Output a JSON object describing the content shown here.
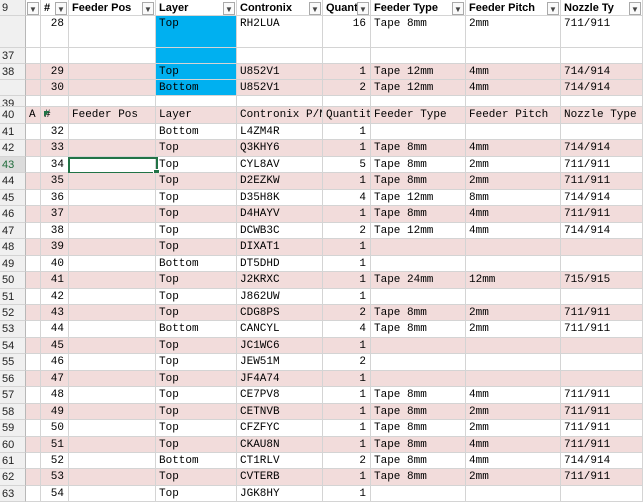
{
  "header_top": {
    "row_header": "9",
    "columns": [
      "#",
      "Feeder Pos",
      "Layer",
      "Contronix",
      "Quanti",
      "Feeder Type",
      "Feeder Pitch",
      "Nozzle Ty"
    ]
  },
  "top_rows": [
    {
      "rh": "",
      "num": "28",
      "pos": "",
      "layer": "Top",
      "part": "RH2LUA",
      "qty": "16",
      "ftype": "Tape 8mm",
      "pitch": "2mm",
      "nozzle": "711/911"
    },
    {
      "rh": "37",
      "num": "",
      "pos": "",
      "layer": "",
      "part": "",
      "qty": "",
      "ftype": "",
      "pitch": "",
      "nozzle": ""
    },
    {
      "rh": "38",
      "num": "29",
      "pos": "",
      "layer": "Top",
      "part": "U852V1",
      "qty": "1",
      "ftype": "Tape 12mm",
      "pitch": "4mm",
      "nozzle": "714/914"
    },
    {
      "rh": "",
      "num": "30",
      "pos": "",
      "layer": "Bottom",
      "part": "U852V1",
      "qty": "2",
      "ftype": "Tape 12mm",
      "pitch": "4mm",
      "nozzle": "714/914"
    },
    {
      "rh": "39",
      "num": "",
      "pos": "",
      "layer": "",
      "part": "",
      "qty": "",
      "ftype": "",
      "pitch": "",
      "nozzle": ""
    }
  ],
  "header_second": {
    "row_header": "40",
    "cells": [
      "A",
      "#",
      "Feeder Pos",
      "Layer",
      "Contronix P/N",
      "Quantity",
      "Feeder Type",
      "Feeder Pitch",
      "Nozzle Type"
    ]
  },
  "rows": [
    {
      "rh": "41",
      "num": "32",
      "layer": "Bottom",
      "part": "L4ZM4R",
      "qty": "1",
      "ftype": "",
      "pitch": "",
      "nozzle": ""
    },
    {
      "rh": "42",
      "num": "33",
      "layer": "Top",
      "part": "Q3KHY6",
      "qty": "1",
      "ftype": "Tape 8mm",
      "pitch": "4mm",
      "nozzle": "714/914"
    },
    {
      "rh": "43",
      "num": "34",
      "layer": "Top",
      "part": "CYL8AV",
      "qty": "5",
      "ftype": "Tape 8mm",
      "pitch": "2mm",
      "nozzle": "711/911"
    },
    {
      "rh": "44",
      "num": "35",
      "layer": "Top",
      "part": "D2EZKW",
      "qty": "1",
      "ftype": "Tape 8mm",
      "pitch": "2mm",
      "nozzle": "711/911"
    },
    {
      "rh": "45",
      "num": "36",
      "layer": "Top",
      "part": "D35H8K",
      "qty": "4",
      "ftype": "Tape 12mm",
      "pitch": "8mm",
      "nozzle": "714/914"
    },
    {
      "rh": "46",
      "num": "37",
      "layer": "Top",
      "part": "D4HAYV",
      "qty": "1",
      "ftype": "Tape 8mm",
      "pitch": "4mm",
      "nozzle": "711/911"
    },
    {
      "rh": "47",
      "num": "38",
      "layer": "Top",
      "part": "DCWB3C",
      "qty": "2",
      "ftype": "Tape 12mm",
      "pitch": "4mm",
      "nozzle": "714/914"
    },
    {
      "rh": "48",
      "num": "39",
      "layer": "Top",
      "part": "DIXAT1",
      "qty": "1",
      "ftype": "",
      "pitch": "",
      "nozzle": ""
    },
    {
      "rh": "49",
      "num": "40",
      "layer": "Bottom",
      "part": "DT5DHD",
      "qty": "1",
      "ftype": "",
      "pitch": "",
      "nozzle": ""
    },
    {
      "rh": "50",
      "num": "41",
      "layer": "Top",
      "part": "J2KRXC",
      "qty": "1",
      "ftype": "Tape 24mm",
      "pitch": "12mm",
      "nozzle": "715/915"
    },
    {
      "rh": "51",
      "num": "42",
      "layer": "Top",
      "part": "J862UW",
      "qty": "1",
      "ftype": "",
      "pitch": "",
      "nozzle": ""
    },
    {
      "rh": "52",
      "num": "43",
      "layer": "Top",
      "part": "CDG8PS",
      "qty": "2",
      "ftype": "Tape 8mm",
      "pitch": "2mm",
      "nozzle": "711/911"
    },
    {
      "rh": "53",
      "num": "44",
      "layer": "Bottom",
      "part": "CANCYL",
      "qty": "4",
      "ftype": "Tape 8mm",
      "pitch": "2mm",
      "nozzle": "711/911"
    },
    {
      "rh": "54",
      "num": "45",
      "layer": "Top",
      "part": "JC1WC6",
      "qty": "1",
      "ftype": "",
      "pitch": "",
      "nozzle": ""
    },
    {
      "rh": "55",
      "num": "46",
      "layer": "Top",
      "part": "JEW51M",
      "qty": "2",
      "ftype": "",
      "pitch": "",
      "nozzle": ""
    },
    {
      "rh": "56",
      "num": "47",
      "layer": "Top",
      "part": "JF4A74",
      "qty": "1",
      "ftype": "",
      "pitch": "",
      "nozzle": ""
    },
    {
      "rh": "57",
      "num": "48",
      "layer": "Top",
      "part": "CE7PV8",
      "qty": "1",
      "ftype": "Tape 8mm",
      "pitch": "4mm",
      "nozzle": "711/911"
    },
    {
      "rh": "58",
      "num": "49",
      "layer": "Top",
      "part": "CETNVB",
      "qty": "1",
      "ftype": "Tape 8mm",
      "pitch": "2mm",
      "nozzle": "711/911"
    },
    {
      "rh": "59",
      "num": "50",
      "layer": "Top",
      "part": "CFZFYC",
      "qty": "1",
      "ftype": "Tape 8mm",
      "pitch": "2mm",
      "nozzle": "711/911"
    },
    {
      "rh": "60",
      "num": "51",
      "layer": "Top",
      "part": "CKAU8N",
      "qty": "1",
      "ftype": "Tape 8mm",
      "pitch": "4mm",
      "nozzle": "711/911"
    },
    {
      "rh": "61",
      "num": "52",
      "layer": "Bottom",
      "part": "CT1RLV",
      "qty": "2",
      "ftype": "Tape 8mm",
      "pitch": "4mm",
      "nozzle": "714/914"
    },
    {
      "rh": "62",
      "num": "53",
      "layer": "Top",
      "part": "CVTERB",
      "qty": "1",
      "ftype": "Tape 8mm",
      "pitch": "2mm",
      "nozzle": "711/911"
    },
    {
      "rh": "63",
      "num": "54",
      "layer": "Top",
      "part": "JGK8HY",
      "qty": "1",
      "ftype": "",
      "pitch": "",
      "nozzle": ""
    }
  ],
  "colors": {
    "band": "#f2dcdb",
    "layer_highlight": "#00b0f0",
    "selection": "#217346"
  }
}
